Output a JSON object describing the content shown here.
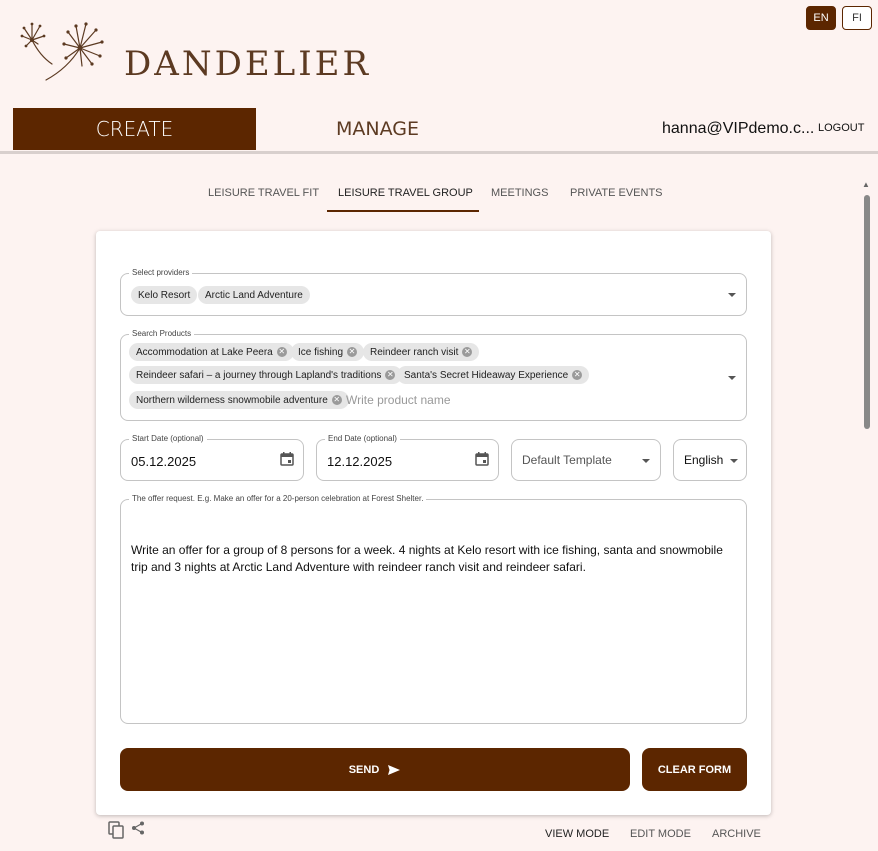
{
  "brand": {
    "name": "DANDELIER"
  },
  "language": {
    "options": [
      "EN",
      "FI"
    ],
    "selected": "EN"
  },
  "nav": {
    "create": "CREATE",
    "manage": "MANAGE",
    "active": "CREATE"
  },
  "user": {
    "email": "hanna@VIPdemo.c...",
    "logout": "LOGOUT"
  },
  "tabs": {
    "items": [
      "LEISURE TRAVEL FIT",
      "LEISURE TRAVEL GROUP",
      "MEETINGS",
      "PRIVATE EVENTS"
    ],
    "active": "LEISURE TRAVEL GROUP"
  },
  "form": {
    "providers": {
      "label": "Select providers",
      "selected": [
        "Kelo Resort",
        "Arctic Land Adventure"
      ]
    },
    "products": {
      "label": "Search Products",
      "selected": [
        "Accommodation at Lake Peera",
        "Ice fishing",
        "Reindeer ranch visit",
        "Reindeer safari – a journey through Lapland's traditions",
        "Santa's Secret Hideaway Experience",
        "Northern wilderness snowmobile adventure"
      ],
      "placeholder": "Write product name"
    },
    "start_date": {
      "label": "Start Date (optional)",
      "value": "05.12.2025"
    },
    "end_date": {
      "label": "End Date (optional)",
      "value": "12.12.2025"
    },
    "template": {
      "value": "Default Template"
    },
    "language": {
      "value": "English"
    },
    "request": {
      "label": "The offer request. E.g. Make an offer for a 20-person celebration at Forest Shelter.",
      "value": "Write an offer for a group of 8 persons for a week. 4 nights at Kelo resort with ice fishing, santa and snowmobile trip and 3 nights at Arctic Land Adventure with reindeer ranch visit and reindeer safari."
    },
    "send": "SEND",
    "clear": "CLEAR FORM"
  },
  "modes": {
    "items": [
      "VIEW MODE",
      "EDIT MODE",
      "ARCHIVE"
    ],
    "active": "VIEW MODE"
  },
  "colors": {
    "accent": "#5c2600",
    "background": "#fdf3f1",
    "brand_text": "#5c3a22"
  }
}
